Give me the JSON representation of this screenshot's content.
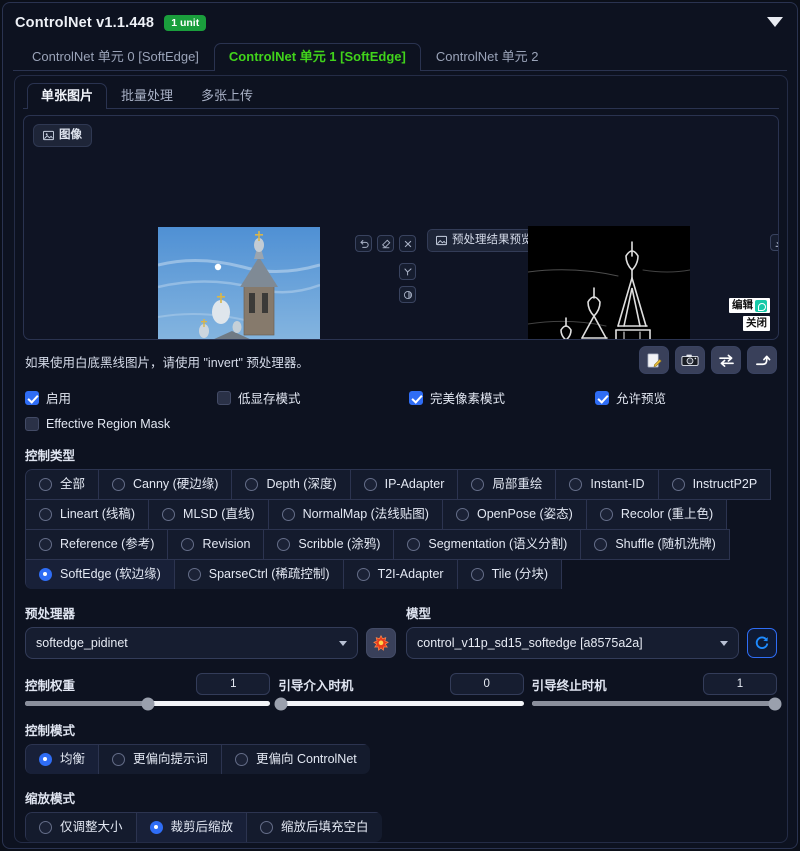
{
  "header": {
    "title": "ControlNet v1.1.448",
    "badge": "1 unit",
    "collapse_icon": "chevron-down-icon"
  },
  "unit_tabs": [
    {
      "label": "ControlNet 单元 0 [SoftEdge]",
      "active": false
    },
    {
      "label": "ControlNet 单元 1 [SoftEdge]",
      "active": true
    },
    {
      "label": "ControlNet 单元 2",
      "active": false
    }
  ],
  "sub_tabs": [
    {
      "label": "单张图片",
      "active": true
    },
    {
      "label": "批量处理",
      "active": false
    },
    {
      "label": "多张上传",
      "active": false
    }
  ],
  "work_area": {
    "image_chip": "图像",
    "preprocess_preview_label": "预处理结果预览",
    "tool_row": [
      "undo-icon",
      "eraser-icon",
      "close-icon"
    ],
    "tool_col": [
      "pen-icon",
      "palette-icon"
    ],
    "download_icon": "download-icon",
    "watermark_edit": "编辑",
    "watermark_close": "关闭"
  },
  "hint": {
    "text": "如果使用白底黑线图片，请使用 \"invert\" 预处理器。",
    "buttons": [
      {
        "icon": "note-edit-icon",
        "glyph": "📝"
      },
      {
        "icon": "camera-icon",
        "glyph": "📷"
      },
      {
        "icon": "swap-arrows-icon",
        "glyph": "⇄"
      },
      {
        "icon": "send-arrow-icon",
        "glyph": "⤴"
      }
    ]
  },
  "checkboxes_row1": [
    {
      "label": "启用",
      "checked": true
    },
    {
      "label": "低显存模式",
      "checked": false
    },
    {
      "label": "完美像素模式",
      "checked": true
    },
    {
      "label": "允许预览",
      "checked": true
    }
  ],
  "checkboxes_row2": [
    {
      "label": "Effective Region Mask",
      "checked": false
    }
  ],
  "control_type": {
    "label": "控制类型",
    "rows": [
      [
        {
          "label": "全部",
          "selected": false
        },
        {
          "label": "Canny (硬边缘)",
          "selected": false
        },
        {
          "label": "Depth (深度)",
          "selected": false
        },
        {
          "label": "IP-Adapter",
          "selected": false
        },
        {
          "label": "局部重绘",
          "selected": false
        },
        {
          "label": "Instant-ID",
          "selected": false
        },
        {
          "label": "InstructP2P",
          "selected": false
        }
      ],
      [
        {
          "label": "Lineart (线稿)",
          "selected": false
        },
        {
          "label": "MLSD (直线)",
          "selected": false
        },
        {
          "label": "NormalMap (法线贴图)",
          "selected": false
        },
        {
          "label": "OpenPose (姿态)",
          "selected": false
        },
        {
          "label": "Recolor (重上色)",
          "selected": false
        }
      ],
      [
        {
          "label": "Reference (参考)",
          "selected": false
        },
        {
          "label": "Revision",
          "selected": false
        },
        {
          "label": "Scribble (涂鸦)",
          "selected": false
        },
        {
          "label": "Segmentation (语义分割)",
          "selected": false
        },
        {
          "label": "Shuffle (随机洗牌)",
          "selected": false
        }
      ],
      [
        {
          "label": "SoftEdge (软边缘)",
          "selected": true
        },
        {
          "label": "SparseCtrl (稀疏控制)",
          "selected": false
        },
        {
          "label": "T2I-Adapter",
          "selected": false
        },
        {
          "label": "Tile (分块)",
          "selected": false
        }
      ]
    ]
  },
  "preprocessor": {
    "label": "预处理器",
    "value": "softedge_pidinet",
    "run_icon": "explosion-icon"
  },
  "model": {
    "label": "模型",
    "value": "control_v11p_sd15_softedge [a8575a2a]",
    "refresh_icon": "refresh-icon"
  },
  "sliders": [
    {
      "name": "控制权重",
      "value": "1",
      "percent": 50
    },
    {
      "name": "引导介入时机",
      "value": "0",
      "percent": 0
    },
    {
      "name": "引导终止时机",
      "value": "1",
      "percent": 100
    }
  ],
  "control_mode": {
    "label": "控制模式",
    "options": [
      {
        "label": "均衡",
        "selected": true
      },
      {
        "label": "更偏向提示词",
        "selected": false
      },
      {
        "label": "更偏向 ControlNet",
        "selected": false
      }
    ]
  },
  "resize_mode": {
    "label": "缩放模式",
    "options": [
      {
        "label": "仅调整大小",
        "selected": false
      },
      {
        "label": "裁剪后缩放",
        "selected": true
      },
      {
        "label": "缩放后填充空白",
        "selected": false
      }
    ]
  },
  "colors": {
    "accent_green": "#41d31b",
    "badge_green": "#1a9e3c",
    "accent_blue": "#2f6df5",
    "panel_bg": "#0d1220",
    "border": "#2a3350"
  }
}
